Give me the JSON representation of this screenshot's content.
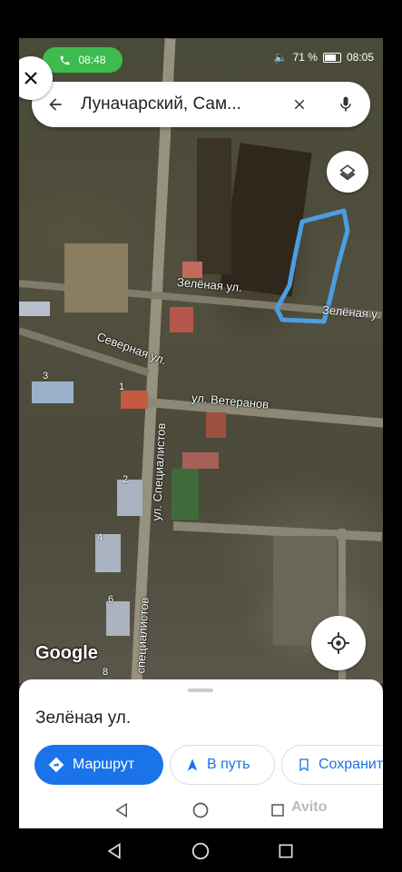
{
  "status": {
    "call_time": "08:48",
    "battery": "71 %",
    "clock": "08:05"
  },
  "search": {
    "query": "Луначарский, Сам..."
  },
  "map": {
    "streets": {
      "zelenaya": "Зелёная ул.",
      "zelenaya_right": "Зелёная у",
      "severnaya": "Северная ул.",
      "veteranov": "ул. Ветеранов",
      "specialistov": "ул. Специалистов",
      "specialistov_lower": "специалистов"
    },
    "house_numbers": [
      "3",
      "1",
      "2",
      "4",
      "6",
      "8"
    ],
    "attribution": "Google",
    "highlight_color": "#4a9fe0"
  },
  "sheet": {
    "place_name": "Зелёная ул.",
    "actions": {
      "route": "Маршрут",
      "go": "В путь",
      "save": "Сохранить"
    }
  },
  "watermark": "Avito",
  "icons": [
    "close-icon",
    "phone-icon",
    "vibrate-icon",
    "battery-icon",
    "back-arrow-icon",
    "clear-icon",
    "mic-icon",
    "layers-icon",
    "my-location-icon",
    "directions-icon",
    "navigation-icon",
    "bookmark-icon",
    "nav-back-icon",
    "nav-home-icon",
    "nav-recents-icon"
  ]
}
